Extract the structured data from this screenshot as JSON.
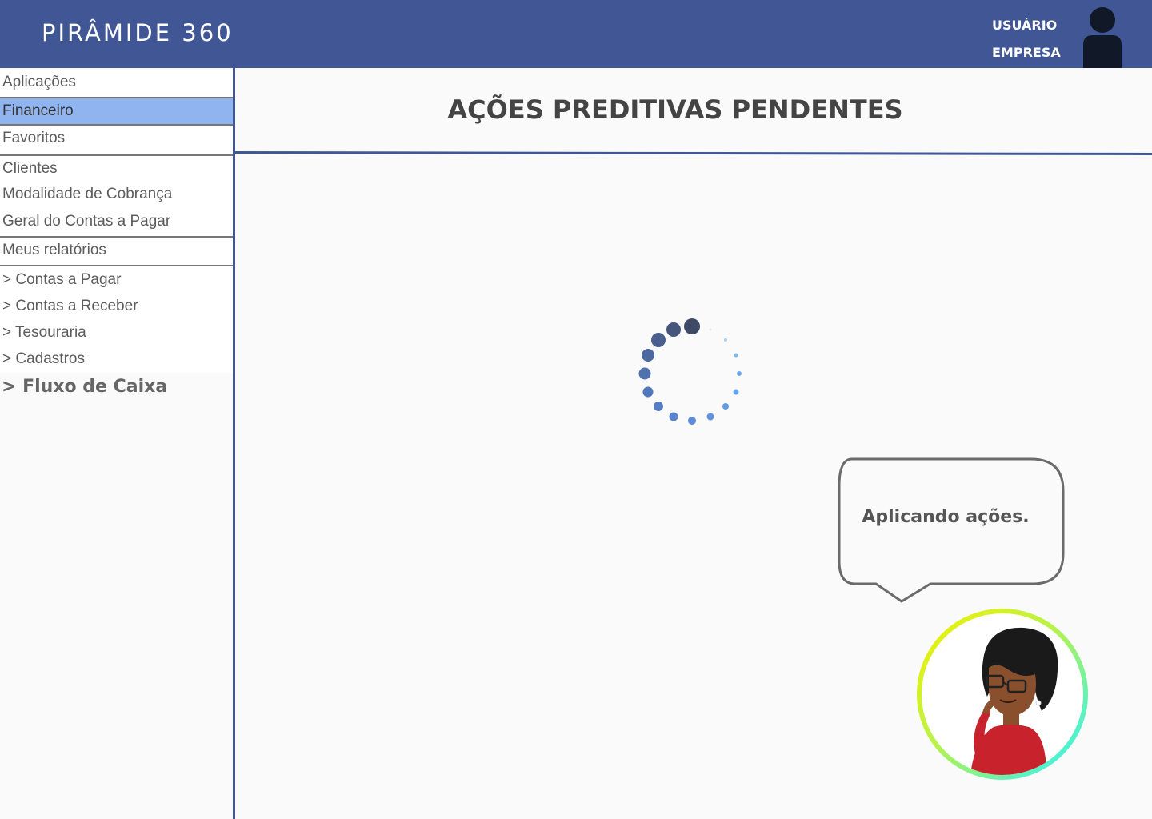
{
  "header": {
    "brand": "PIRÂMIDE 360",
    "user_label": "USUÁRIO",
    "company_label": "EMPRESA"
  },
  "sidebar": {
    "applications": "Aplicações",
    "financial": "Financeiro",
    "favorites": "Favoritos",
    "clients": "Clientes",
    "billing_mode": "Modalidade de Cobrança",
    "payables_general": "Geral do Contas a Pagar",
    "my_reports": "Meus relatórios",
    "reports": [
      "> Contas a Pagar",
      "> Contas a Receber",
      "> Tesouraria",
      "> Cadastros"
    ],
    "cash_flow": "> Fluxo de Caixa"
  },
  "main": {
    "title": "AÇÕES PREDITIVAS PENDENTES",
    "bubble_text": "Aplicando ações."
  },
  "colors": {
    "header": "#415695",
    "selected": "#8fb4ef",
    "spinner_dark": "#3f4b66",
    "spinner_light": "#6ab0e8"
  }
}
